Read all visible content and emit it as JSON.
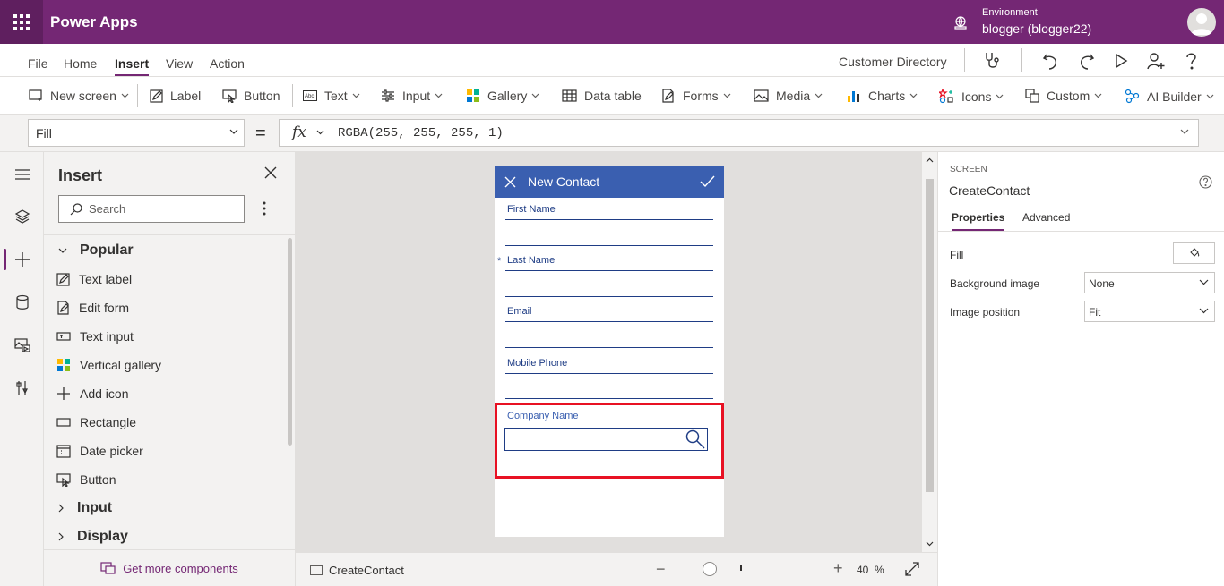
{
  "titlebar": {
    "app_name": "Power Apps",
    "environment_label": "Environment",
    "environment_value": "blogger (blogger22)",
    "brand_color": "#742774"
  },
  "menu": {
    "items": [
      "File",
      "Home",
      "Insert",
      "View",
      "Action"
    ],
    "active": "Insert",
    "app_title": "Customer Directory"
  },
  "ribbon": {
    "new_screen": "New screen",
    "label": "Label",
    "button": "Button",
    "text": "Text",
    "input": "Input",
    "gallery": "Gallery",
    "data_table": "Data table",
    "forms": "Forms",
    "media": "Media",
    "charts": "Charts",
    "icons": "Icons",
    "custom": "Custom",
    "ai_builder": "AI Builder"
  },
  "formula": {
    "property": "Fill",
    "equals": "=",
    "fx": "fx",
    "expression": "RGBA(255, 255, 255, 1)"
  },
  "insert_panel": {
    "title": "Insert",
    "search_placeholder": "Search",
    "popular": "Popular",
    "items": [
      "Text label",
      "Edit form",
      "Text input",
      "Vertical gallery",
      "Add icon",
      "Rectangle",
      "Date picker",
      "Button"
    ],
    "categories": [
      "Input",
      "Display"
    ],
    "footer": "Get more components"
  },
  "screen": {
    "header_title": "New Contact",
    "header_color": "#3a5fb0",
    "fields": [
      "First Name",
      "Last Name",
      "Email",
      "Mobile Phone"
    ],
    "required_marker": "*",
    "company_label": "Company Name"
  },
  "statusbar": {
    "screen_name": "CreateContact",
    "zoom_minus": "−",
    "zoom_plus": "+",
    "zoom_value": "40",
    "zoom_unit": "%"
  },
  "properties": {
    "kind": "SCREEN",
    "name": "CreateContact",
    "tabs": [
      "Properties",
      "Advanced"
    ],
    "fill_label": "Fill",
    "bg_image_label": "Background image",
    "bg_image_value": "None",
    "image_pos_label": "Image position",
    "image_pos_value": "Fit"
  }
}
